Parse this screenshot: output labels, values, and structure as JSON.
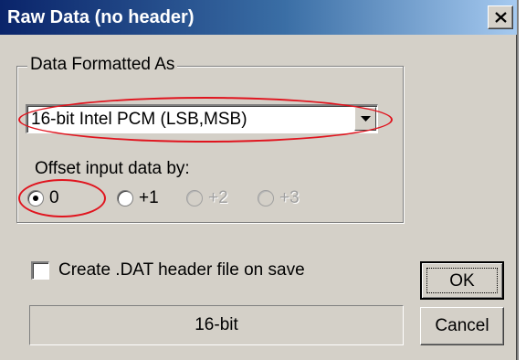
{
  "window": {
    "title": "Raw Data (no header)",
    "close_icon": "close-icon",
    "title_gradient": [
      "#0a246a",
      "#a6caf0"
    ],
    "face_color": "#d4d0c8"
  },
  "format_group": {
    "legend": "Data Formatted As",
    "combo": {
      "value": "16-bit Intel PCM (LSB,MSB)",
      "arrow_icon": "chevron-down-icon"
    },
    "offset_label": "Offset input data by:",
    "offsets": [
      {
        "label": "0",
        "selected": true,
        "enabled": true
      },
      {
        "label": "+1",
        "selected": false,
        "enabled": true
      },
      {
        "label": "+2",
        "selected": false,
        "enabled": false
      },
      {
        "label": "+3",
        "selected": false,
        "enabled": false
      }
    ]
  },
  "create_dat": {
    "label": "Create .DAT header file on save",
    "checked": false
  },
  "status": "16-bit",
  "buttons": {
    "ok": "OK",
    "cancel": "Cancel"
  },
  "annotation_color": "#e0141e"
}
